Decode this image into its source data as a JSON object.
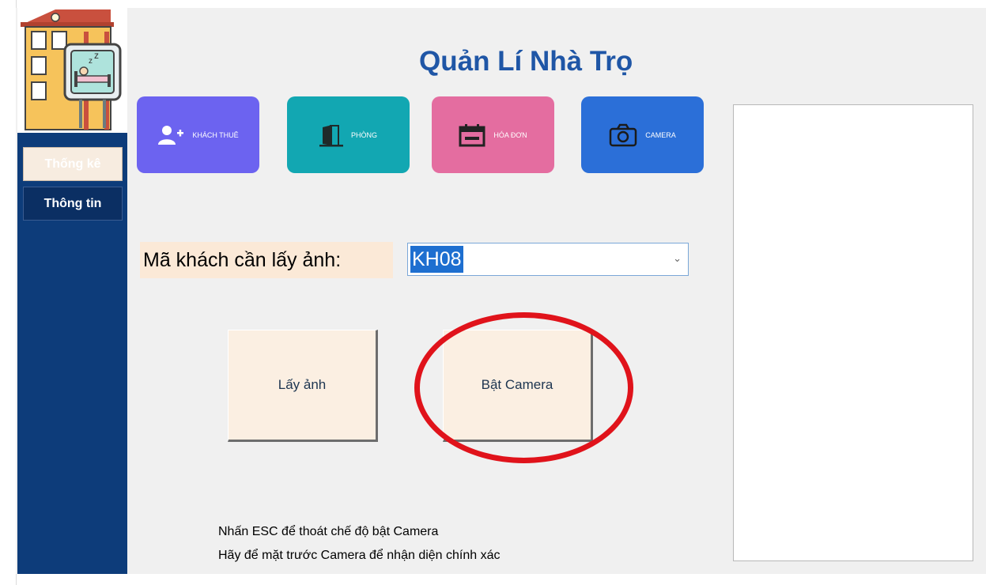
{
  "app": {
    "title": "Quản Lí Nhà Trọ"
  },
  "sidebar": {
    "items": [
      {
        "label": "Thống kê"
      },
      {
        "label": "Thông tin"
      }
    ]
  },
  "nav": {
    "tiles": [
      {
        "label": "KHÁCH THUÊ",
        "icon": "add-user-icon",
        "color": "#6c63f0"
      },
      {
        "label": "PHÒNG",
        "icon": "door-icon",
        "color": "#12a7b2"
      },
      {
        "label": "HÓA ĐƠN",
        "icon": "calendar-icon",
        "color": "#e46da0"
      },
      {
        "label": "CAMERA",
        "icon": "camera-icon",
        "color": "#2b6fd8"
      }
    ]
  },
  "form": {
    "customer_label": "Mã khách cần lấy ảnh:",
    "customer_value": "KH08"
  },
  "actions": {
    "take_photo": "Lấy ảnh",
    "turn_on_camera": "Bật Camera"
  },
  "notes": {
    "line1": "Nhấn ESC để thoát chế độ bật Camera",
    "line2": "Hãy để mặt trước Camera để nhận diện chính xác"
  },
  "colors": {
    "title": "#1f56a6",
    "sidebar": "#0d3c7a",
    "annotation": "#e0131b"
  }
}
